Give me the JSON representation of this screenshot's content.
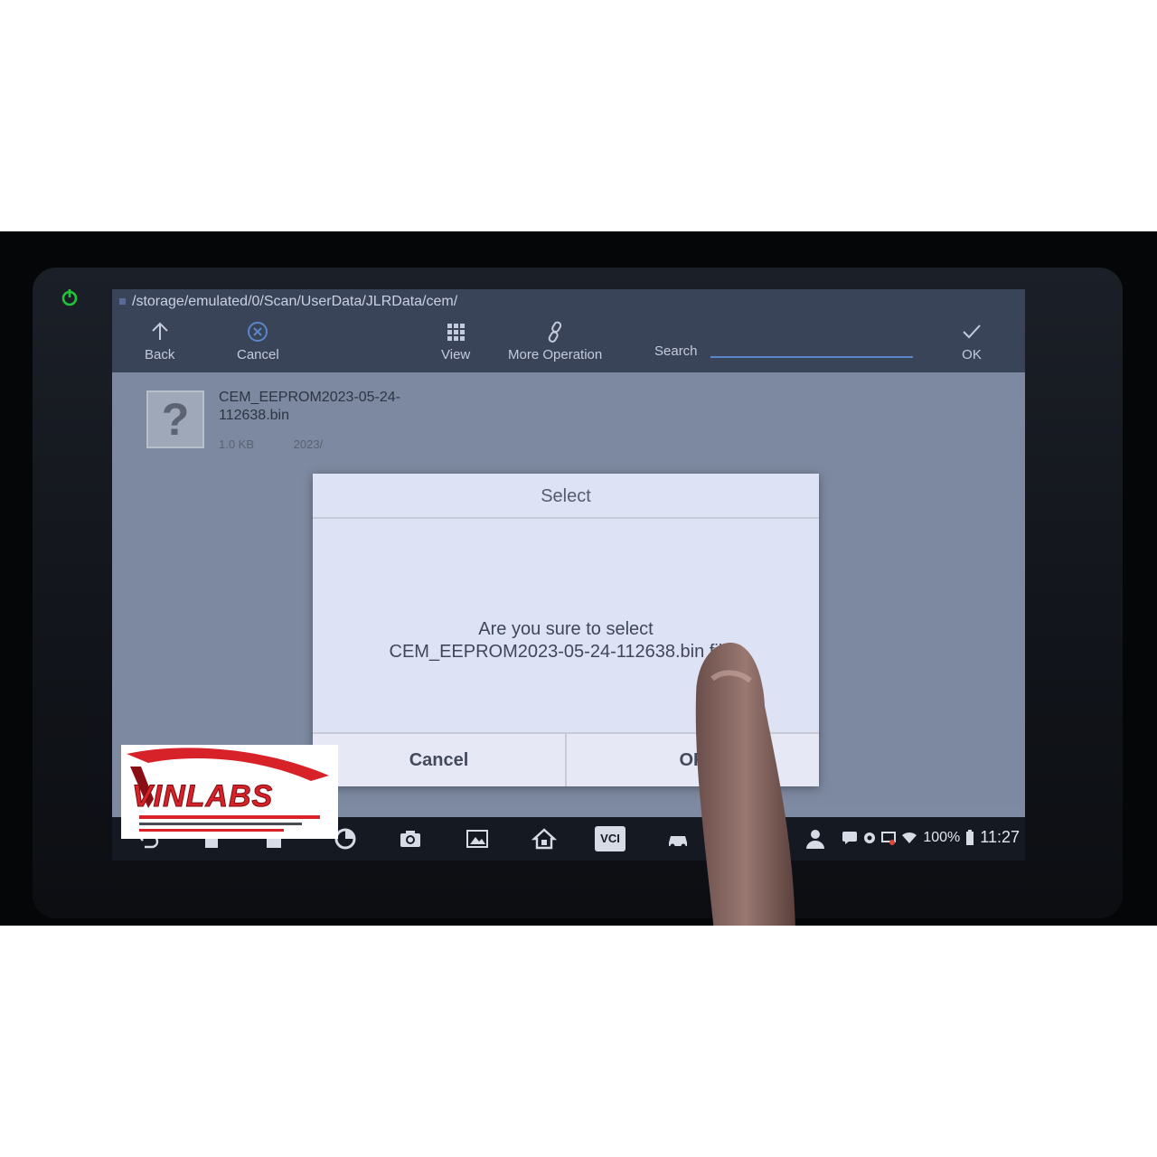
{
  "path_bar": {
    "path": "/storage/emulated/0/Scan/UserData/JLRData/cem/"
  },
  "toolbar": {
    "back_label": "Back",
    "cancel_label": "Cancel",
    "view_label": "View",
    "more_operation_label": "More Operation",
    "search_label": "Search",
    "ok_label": "OK"
  },
  "file_list": {
    "items": [
      {
        "name": "CEM_EEPROM2023-05-24-112638.bin",
        "size": "1.0 KB",
        "date": "2023/",
        "icon": "unknown-file-icon"
      }
    ]
  },
  "dialog": {
    "title": "Select",
    "message_line1": "Are you sure to select",
    "message_line2": "CEM_EEPROM2023-05-24-112638.bin file?",
    "cancel_label": "Cancel",
    "ok_label": "OK"
  },
  "status_bar": {
    "battery": "100%",
    "time": "11:27",
    "icons": [
      "message-icon",
      "settings-icon",
      "device-icon",
      "wifi-icon",
      "battery-icon"
    ]
  },
  "taskbar": {
    "icons": [
      "back-nav-icon",
      "home-nav-icon",
      "recent-apps-icon",
      "browser-icon",
      "camera-icon",
      "screenshot-icon",
      "home-icon",
      "vci-icon",
      "car-icon",
      "support-icon"
    ],
    "vci_label": "VCI"
  },
  "watermark": {
    "text": "VINLABS"
  },
  "colors": {
    "accent_blue": "#5b86c9",
    "power_green": "#22c33a",
    "logo_red": "#d8222a",
    "toolbar_bg": "#3a4458",
    "dialog_bg": "#dde2f4"
  }
}
